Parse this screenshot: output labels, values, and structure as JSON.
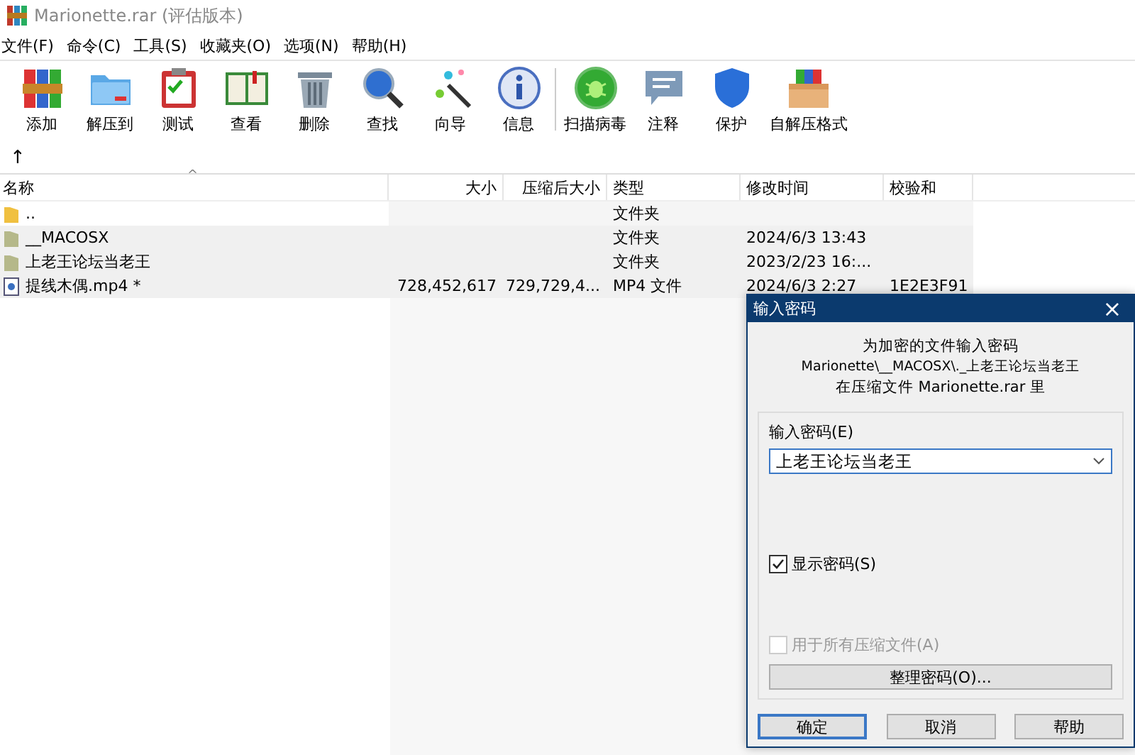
{
  "window": {
    "title": "Marionette.rar (评估版本)"
  },
  "menu": [
    "文件(F)",
    "命令(C)",
    "工具(S)",
    "收藏夹(O)",
    "选项(N)",
    "帮助(H)"
  ],
  "toolbar": [
    {
      "label": "添加"
    },
    {
      "label": "解压到"
    },
    {
      "label": "测试"
    },
    {
      "label": "查看"
    },
    {
      "label": "删除"
    },
    {
      "label": "查找"
    },
    {
      "label": "向导"
    },
    {
      "label": "信息"
    },
    {
      "label": "扫描病毒"
    },
    {
      "label": "注释"
    },
    {
      "label": "保护"
    },
    {
      "label": "自解压格式"
    }
  ],
  "up_arrow": "↑",
  "table": {
    "sort_mark": "^",
    "columns": [
      "名称",
      "大小",
      "压缩后大小",
      "类型",
      "修改时间",
      "校验和"
    ],
    "rows": [
      {
        "kind": "up",
        "name": "..",
        "size": "",
        "packed": "",
        "type": "文件夹",
        "modified": "",
        "crc": "",
        "selected": false
      },
      {
        "kind": "folder",
        "name": "__MACOSX",
        "size": "",
        "packed": "",
        "type": "文件夹",
        "modified": "2024/6/3 13:43",
        "crc": "",
        "selected": true
      },
      {
        "kind": "folder",
        "name": "上老王论坛当老王",
        "size": "",
        "packed": "",
        "type": "文件夹",
        "modified": "2023/2/23 16:...",
        "crc": "",
        "selected": true
      },
      {
        "kind": "file",
        "name": "提线木偶.mp4 *",
        "size": "728,452,617",
        "packed": "729,729,4...",
        "type": "MP4 文件",
        "modified": "2024/6/3 2:27",
        "crc": "1E2E3F91",
        "selected": true
      }
    ]
  },
  "dialog": {
    "title": "输入密码",
    "close": "×",
    "message": [
      "为加密的文件输入密码",
      "Marionette\\__MACOSX\\._上老王论坛当老王",
      "在压缩文件 Marionette.rar 里"
    ],
    "password_label": "输入密码(E)",
    "password_value": "上老王论坛当老王",
    "show_password": {
      "label": "显示密码(S)",
      "checked": true,
      "disabled": false
    },
    "all_archives": {
      "label": "用于所有压缩文件(A)",
      "checked": false,
      "disabled": true
    },
    "organize_button": "整理密码(O)...",
    "buttons": [
      {
        "label": "确定",
        "default": true
      },
      {
        "label": "取消",
        "default": false
      },
      {
        "label": "帮助",
        "default": false
      }
    ]
  }
}
